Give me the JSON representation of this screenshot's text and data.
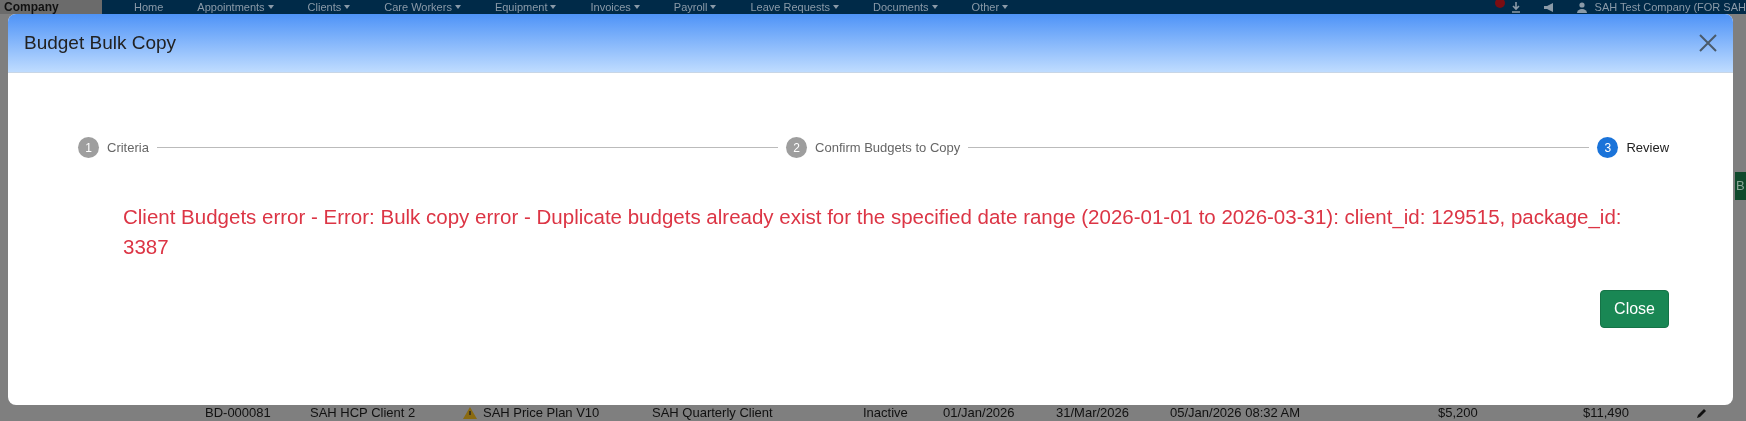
{
  "navbar": {
    "brand": "Company",
    "items": [
      {
        "label": "Home",
        "dropdown": false
      },
      {
        "label": "Appointments",
        "dropdown": true
      },
      {
        "label": "Clients",
        "dropdown": true
      },
      {
        "label": "Care Workers",
        "dropdown": true
      },
      {
        "label": "Equipment",
        "dropdown": true
      },
      {
        "label": "Invoices",
        "dropdown": true
      },
      {
        "label": "Payroll",
        "dropdown": true
      },
      {
        "label": "Leave Requests",
        "dropdown": true
      },
      {
        "label": "Documents",
        "dropdown": true
      },
      {
        "label": "Other",
        "dropdown": true
      }
    ],
    "user": "SAH Test Company (FOR SAH"
  },
  "side_button": "B",
  "background_row": {
    "cells": [
      {
        "text": "BD-000081",
        "warning": false
      },
      {
        "text": "SAH HCP Client 2",
        "warning": false
      },
      {
        "text": "SAH Price Plan V10",
        "warning": true
      },
      {
        "text": "SAH Quarterly Client",
        "warning": false
      },
      {
        "text": "Inactive",
        "warning": false
      },
      {
        "text": "01/Jan/2026",
        "warning": false
      },
      {
        "text": "31/Mar/2026",
        "warning": false
      },
      {
        "text": "05/Jan/2026 08:32 AM",
        "warning": false
      },
      {
        "text": "$5,200",
        "warning": false
      },
      {
        "text": "$11,490",
        "warning": false
      }
    ]
  },
  "modal": {
    "title": "Budget Bulk Copy",
    "steps": [
      {
        "number": "1",
        "label": "Criteria",
        "selected": false
      },
      {
        "number": "2",
        "label": "Confirm Budgets to Copy",
        "selected": false
      },
      {
        "number": "3",
        "label": "Review",
        "selected": true
      }
    ],
    "error": "Client Budgets error - Error: Bulk copy error - Duplicate budgets already exist for the specified date range (2026-01-01 to 2026-03-31): client_id: 129515, package_id: 3387",
    "buttons": [
      "Close"
    ]
  }
}
